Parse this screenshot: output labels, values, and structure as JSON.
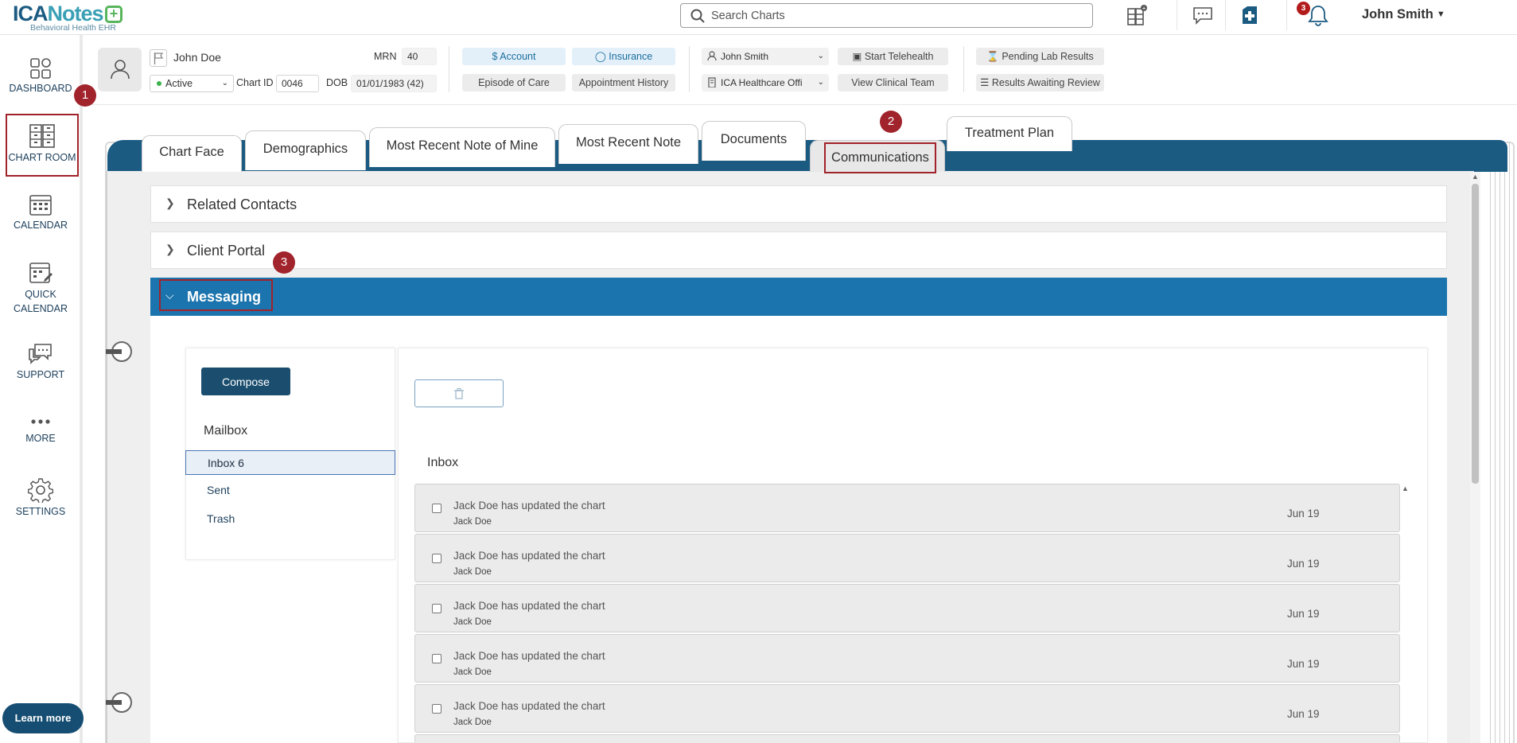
{
  "app": {
    "logo_primary_a": "ICA",
    "logo_primary_b": "Notes",
    "logo_plus": "+",
    "logo_sub": "Behavioral Health EHR"
  },
  "topbar": {
    "search_placeholder": "Search Charts",
    "notification_count": "3",
    "user_name": "John Smith",
    "icons": [
      "chart-cabinet-icon",
      "chat-bubble-icon",
      "medical-plus-icon",
      "bell-icon"
    ]
  },
  "sidebar": {
    "items": [
      {
        "label": "DASHBOARD",
        "icon": "dashboard-grid-icon"
      },
      {
        "label": "CHART ROOM",
        "icon": "file-cabinet-icon"
      },
      {
        "label": "CALENDAR",
        "icon": "calendar-icon"
      },
      {
        "label": "QUICK",
        "label2": "CALENDAR",
        "icon": "quick-calendar-icon"
      },
      {
        "label": "SUPPORT",
        "icon": "support-chat-icon"
      },
      {
        "label": "MORE",
        "icon": "more-dots-icon"
      },
      {
        "label": "SETTINGS",
        "icon": "gear-icon"
      }
    ],
    "learn_more": "Learn more"
  },
  "callouts": [
    "1",
    "2",
    "3"
  ],
  "patient": {
    "name": "John Doe",
    "status": "Active",
    "mrn_label": "MRN",
    "mrn": "40",
    "chart_id_label": "Chart ID",
    "chart_id": "0046",
    "dob_label": "DOB",
    "dob": "01/01/1983 (42)",
    "account": "Account",
    "insurance": "Insurance",
    "episode": "Episode of Care",
    "appt_history": "Appointment History",
    "provider": "John Smith",
    "office": "ICA Healthcare Offi",
    "start_telehealth": "Start Telehealth",
    "view_team": "View Clinical Team",
    "pending_labs": "Pending Lab Results",
    "results_review": "Results Awaiting Review"
  },
  "tabs": [
    "Chart Face",
    "Demographics",
    "Most Recent Note of Mine",
    "Most Recent Note",
    "Documents",
    "Communications",
    "Treatment Plan"
  ],
  "sections": {
    "related_contacts": "Related Contacts",
    "client_portal": "Client Portal",
    "messaging": "Messaging"
  },
  "messaging": {
    "compose": "Compose",
    "mailbox_title": "Mailbox",
    "folders": [
      "Inbox 6",
      "Sent",
      "Trash"
    ],
    "inbox_title": "Inbox",
    "messages": [
      {
        "subject": "Jack Doe has updated the chart",
        "from": "Jack Doe",
        "date": "Jun 19"
      },
      {
        "subject": "Jack Doe has updated the chart",
        "from": "Jack Doe",
        "date": "Jun 19"
      },
      {
        "subject": "Jack Doe has updated the chart",
        "from": "Jack Doe",
        "date": "Jun 19"
      },
      {
        "subject": "Jack Doe has updated the chart",
        "from": "Jack Doe",
        "date": "Jun 19"
      },
      {
        "subject": "Jack Doe has updated the chart",
        "from": "Jack Doe",
        "date": "Jun 19"
      }
    ]
  },
  "colors": {
    "brand_dark": "#1b5b82",
    "brand_teal": "#3aa0b5",
    "accent_red": "#a1232b",
    "section_open": "#1b74ad",
    "compose_bg": "#1b4e6e"
  }
}
